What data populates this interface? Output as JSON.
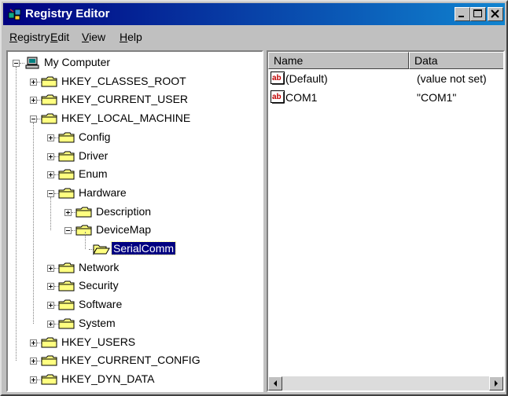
{
  "window": {
    "title": "Registry Editor",
    "buttons": {
      "minimize": "minimize",
      "maximize": "maximize",
      "close": "close"
    }
  },
  "menu": [
    {
      "label": "Registry",
      "mnemonic": "R"
    },
    {
      "label": "Edit",
      "mnemonic": "E"
    },
    {
      "label": "View",
      "mnemonic": "V"
    },
    {
      "label": "Help",
      "mnemonic": "H"
    }
  ],
  "tree": [
    {
      "label": "My Computer",
      "level": 0,
      "state": "expanded",
      "icon": "computer-icon"
    },
    {
      "label": "HKEY_CLASSES_ROOT",
      "level": 1,
      "state": "collapsed",
      "icon": "folder-icon"
    },
    {
      "label": "HKEY_CURRENT_USER",
      "level": 1,
      "state": "collapsed",
      "icon": "folder-icon"
    },
    {
      "label": "HKEY_LOCAL_MACHINE",
      "level": 1,
      "state": "expanded",
      "icon": "folder-icon"
    },
    {
      "label": "Config",
      "level": 2,
      "state": "collapsed",
      "icon": "folder-icon"
    },
    {
      "label": "Driver",
      "level": 2,
      "state": "collapsed",
      "icon": "folder-icon"
    },
    {
      "label": "Enum",
      "level": 2,
      "state": "collapsed",
      "icon": "folder-icon"
    },
    {
      "label": "Hardware",
      "level": 2,
      "state": "expanded",
      "icon": "folder-icon"
    },
    {
      "label": "Description",
      "level": 3,
      "state": "collapsed",
      "icon": "folder-icon"
    },
    {
      "label": "DeviceMap",
      "level": 3,
      "state": "expanded",
      "icon": "folder-icon"
    },
    {
      "label": "SerialComm",
      "level": 4,
      "state": "leaf",
      "icon": "open-folder-icon",
      "selected": true
    },
    {
      "label": "Network",
      "level": 2,
      "state": "collapsed",
      "icon": "folder-icon"
    },
    {
      "label": "Security",
      "level": 2,
      "state": "collapsed",
      "icon": "folder-icon"
    },
    {
      "label": "Software",
      "level": 2,
      "state": "collapsed",
      "icon": "folder-icon"
    },
    {
      "label": "System",
      "level": 2,
      "state": "collapsed",
      "icon": "folder-icon"
    },
    {
      "label": "HKEY_USERS",
      "level": 1,
      "state": "collapsed",
      "icon": "folder-icon"
    },
    {
      "label": "HKEY_CURRENT_CONFIG",
      "level": 1,
      "state": "collapsed",
      "icon": "folder-icon"
    },
    {
      "label": "HKEY_DYN_DATA",
      "level": 1,
      "state": "collapsed",
      "icon": "folder-icon"
    }
  ],
  "values": {
    "columns": [
      "Name",
      "Data"
    ],
    "rows": [
      {
        "name": "(Default)",
        "data": "(value not set)",
        "icon": "string-value-icon"
      },
      {
        "name": "COM1",
        "data": "\"COM1\"",
        "icon": "string-value-icon"
      }
    ]
  },
  "colors": {
    "face": "#c0c0c0",
    "title_start": "#000080",
    "title_end": "#1084d0",
    "selection": "#000080",
    "folder": "#ffff80"
  }
}
